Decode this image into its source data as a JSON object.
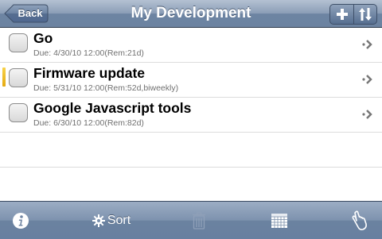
{
  "navbar": {
    "back_label": "Back",
    "title": "My Development",
    "add_icon": "plus-icon",
    "sort_icon": "sort-arrows-icon"
  },
  "tasks": [
    {
      "title": "Go",
      "due": "Due: 4/30/10 12:00(Rem:21d)",
      "flagged": false
    },
    {
      "title": "Firmware update",
      "due": "Due: 5/31/10 12:00(Rem:52d,biweekly)",
      "flagged": true
    },
    {
      "title": "Google Javascript tools",
      "due": "Due: 6/30/10 12:00(Rem:82d)",
      "flagged": false
    }
  ],
  "toolbar": {
    "info_icon": "info-icon",
    "sort_label": "Sort",
    "sort_icon": "gear-icon",
    "trash_icon": "trash-icon",
    "calendar_icon": "calendar-icon",
    "tap_icon": "hand-tap-icon"
  },
  "colors": {
    "navbar": "#7d92ae",
    "flag": "#f0c030",
    "due_text": "#707070"
  }
}
